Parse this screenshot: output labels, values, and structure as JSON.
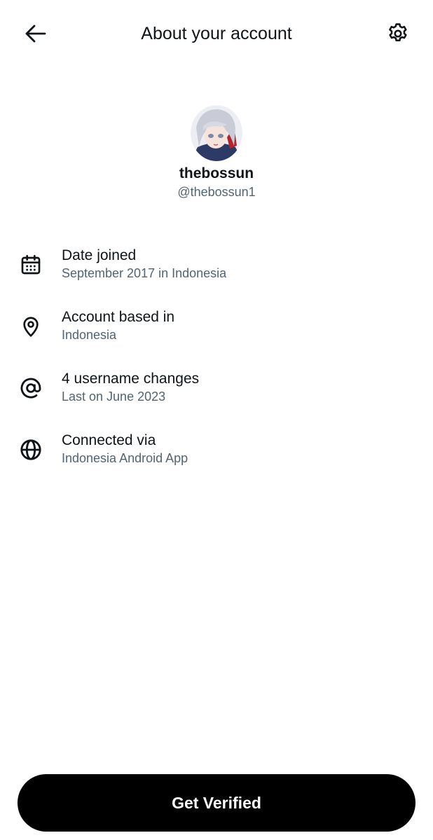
{
  "header": {
    "title": "About your account",
    "back_icon": "arrow-left-icon",
    "settings_icon": "gear-icon"
  },
  "profile": {
    "display_name": "thebossun",
    "handle": "@thebossun1"
  },
  "info": [
    {
      "icon": "calendar-icon",
      "label": "Date joined",
      "value": "September 2017 in Indonesia"
    },
    {
      "icon": "location-pin-icon",
      "label": "Account based in",
      "value": "Indonesia"
    },
    {
      "icon": "at-sign-icon",
      "label": "4 username changes",
      "value": "Last on June 2023"
    },
    {
      "icon": "globe-icon",
      "label": "Connected via",
      "value": "Indonesia Android App"
    }
  ],
  "cta": {
    "label": "Get Verified"
  },
  "colors": {
    "primary_text": "#0f1419",
    "secondary_text": "#536471",
    "button_bg": "#000000",
    "button_text": "#ffffff"
  }
}
